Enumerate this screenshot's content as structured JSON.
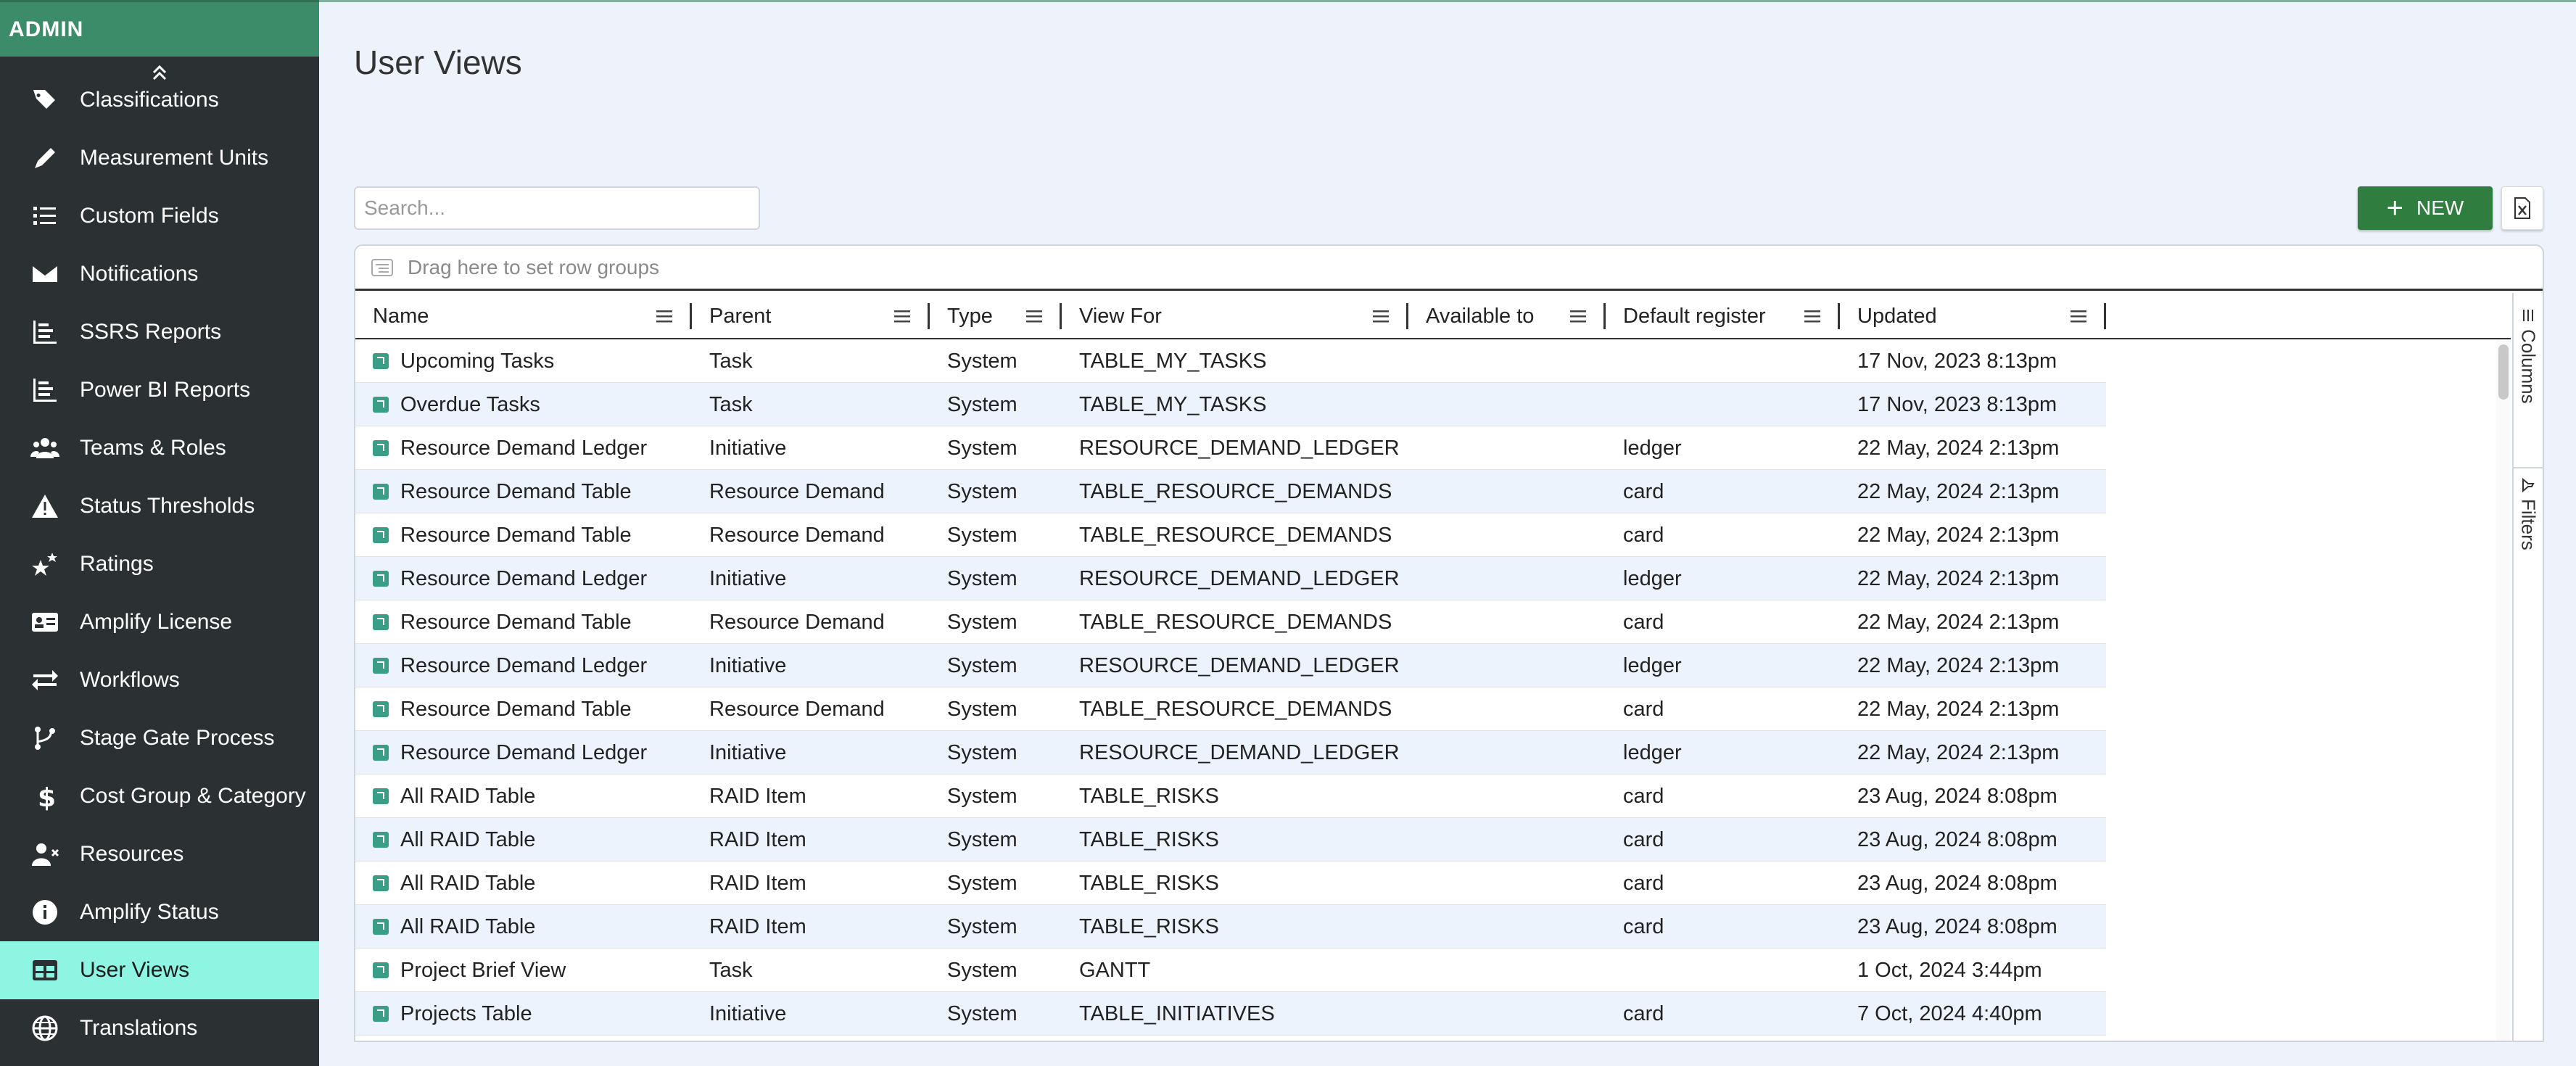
{
  "sidebar": {
    "header": "ADMIN",
    "items": [
      {
        "label": "Classifications",
        "icon": "tags-icon"
      },
      {
        "label": "Measurement Units",
        "icon": "ruler-pencil-icon"
      },
      {
        "label": "Custom Fields",
        "icon": "list-icon"
      },
      {
        "label": "Notifications",
        "icon": "envelope-icon"
      },
      {
        "label": "SSRS Reports",
        "icon": "report-icon"
      },
      {
        "label": "Power BI Reports",
        "icon": "report-icon"
      },
      {
        "label": "Teams & Roles",
        "icon": "users-icon"
      },
      {
        "label": "Status Thresholds",
        "icon": "warning-icon"
      },
      {
        "label": "Ratings",
        "icon": "stars-icon"
      },
      {
        "label": "Amplify License",
        "icon": "id-card-icon"
      },
      {
        "label": "Workflows",
        "icon": "arrows-exchange-icon"
      },
      {
        "label": "Stage Gate Process",
        "icon": "branch-icon"
      },
      {
        "label": "Cost Group & Category",
        "icon": "dollar-icon"
      },
      {
        "label": "Resources",
        "icon": "user-remove-icon"
      },
      {
        "label": "Amplify Status",
        "icon": "info-icon"
      },
      {
        "label": "User Views",
        "icon": "table-icon",
        "active": true
      },
      {
        "label": "Translations",
        "icon": "globe-icon"
      }
    ]
  },
  "page": {
    "title": "User Views",
    "search_placeholder": "Search...",
    "new_label": "NEW",
    "row_group_hint": "Drag here to set row groups"
  },
  "grid": {
    "columns": [
      "Name",
      "Parent",
      "Type",
      "View For",
      "Available to",
      "Default register",
      "Updated"
    ],
    "rows": [
      [
        "Upcoming Tasks",
        "Task",
        "System",
        "TABLE_MY_TASKS",
        "",
        "",
        "17 Nov, 2023 8:13pm"
      ],
      [
        "Overdue Tasks",
        "Task",
        "System",
        "TABLE_MY_TASKS",
        "",
        "",
        "17 Nov, 2023 8:13pm"
      ],
      [
        "Resource Demand Ledger",
        "Initiative",
        "System",
        "RESOURCE_DEMAND_LEDGER",
        "",
        "ledger",
        "22 May, 2024 2:13pm"
      ],
      [
        "Resource Demand Table",
        "Resource Demand",
        "System",
        "TABLE_RESOURCE_DEMANDS",
        "",
        "card",
        "22 May, 2024 2:13pm"
      ],
      [
        "Resource Demand Table",
        "Resource Demand",
        "System",
        "TABLE_RESOURCE_DEMANDS",
        "",
        "card",
        "22 May, 2024 2:13pm"
      ],
      [
        "Resource Demand Ledger",
        "Initiative",
        "System",
        "RESOURCE_DEMAND_LEDGER",
        "",
        "ledger",
        "22 May, 2024 2:13pm"
      ],
      [
        "Resource Demand Table",
        "Resource Demand",
        "System",
        "TABLE_RESOURCE_DEMANDS",
        "",
        "card",
        "22 May, 2024 2:13pm"
      ],
      [
        "Resource Demand Ledger",
        "Initiative",
        "System",
        "RESOURCE_DEMAND_LEDGER",
        "",
        "ledger",
        "22 May, 2024 2:13pm"
      ],
      [
        "Resource Demand Table",
        "Resource Demand",
        "System",
        "TABLE_RESOURCE_DEMANDS",
        "",
        "card",
        "22 May, 2024 2:13pm"
      ],
      [
        "Resource Demand Ledger",
        "Initiative",
        "System",
        "RESOURCE_DEMAND_LEDGER",
        "",
        "ledger",
        "22 May, 2024 2:13pm"
      ],
      [
        "All RAID Table",
        "RAID Item",
        "System",
        "TABLE_RISKS",
        "",
        "card",
        "23 Aug, 2024 8:08pm"
      ],
      [
        "All RAID Table",
        "RAID Item",
        "System",
        "TABLE_RISKS",
        "",
        "card",
        "23 Aug, 2024 8:08pm"
      ],
      [
        "All RAID Table",
        "RAID Item",
        "System",
        "TABLE_RISKS",
        "",
        "card",
        "23 Aug, 2024 8:08pm"
      ],
      [
        "All RAID Table",
        "RAID Item",
        "System",
        "TABLE_RISKS",
        "",
        "card",
        "23 Aug, 2024 8:08pm"
      ],
      [
        "Project Brief View",
        "Task",
        "System",
        "GANTT",
        "",
        "",
        "1 Oct, 2024 3:44pm"
      ],
      [
        "Projects Table",
        "Initiative",
        "System",
        "TABLE_INITIATIVES",
        "",
        "card",
        "7 Oct, 2024 4:40pm"
      ]
    ]
  },
  "side_panel": {
    "columns_label": "Columns",
    "filters_label": "Filters"
  },
  "colors": {
    "sidebar_bg": "#2b3033",
    "header_bg": "#3c8c6a",
    "active_item_bg": "#8ff5e3",
    "new_button_bg": "#2f7d3f",
    "row_icon": "#3a9e86"
  }
}
